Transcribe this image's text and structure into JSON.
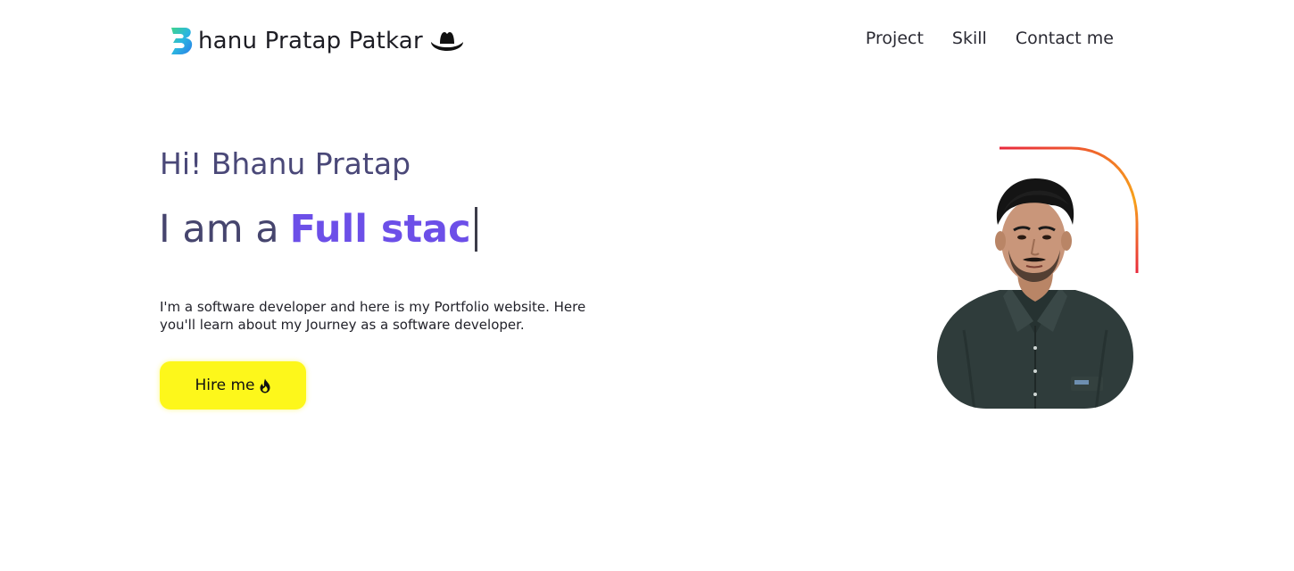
{
  "header": {
    "brand_name": "hanu Pratap Patkar",
    "brand_logo_icon": "b-letter-logo-icon",
    "hat_icon": "cowboy-hat-icon",
    "nav": [
      {
        "label": "Project"
      },
      {
        "label": "Skill"
      },
      {
        "label": "Contact me"
      }
    ]
  },
  "hero": {
    "greeting": "Hi! Bhanu Pratap",
    "headline_prefix": "I am a",
    "headline_typed": "Full stac",
    "intro": "I'm a software developer and here is my Portfolio website. Here you'll learn about my Journey as a software developer.",
    "cta_label": "Hire me",
    "cta_icon": "flame-icon"
  },
  "colors": {
    "accent": "#6c4fe8",
    "heading": "#4a4878",
    "cta_background": "#fdf71b",
    "arc_gradient": [
      "#e8283c",
      "#f7a21b"
    ]
  }
}
